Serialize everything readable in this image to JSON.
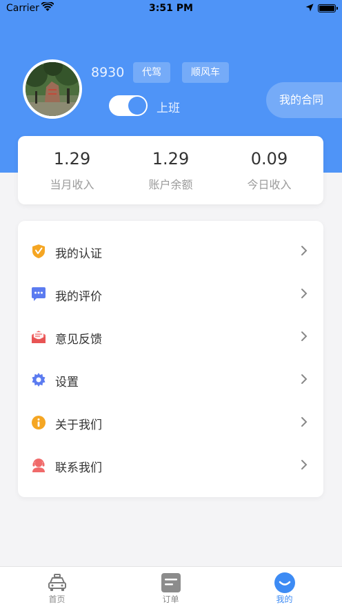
{
  "status_bar": {
    "carrier": "Carrier",
    "time": "3:51 PM"
  },
  "profile": {
    "user_id": "8930",
    "tags": [
      "代驾",
      "顺风车"
    ],
    "toggle_label": "上班",
    "toggle_on": true,
    "contract_button": "我的合同"
  },
  "stats": [
    {
      "value": "1.29",
      "label": "当月收入"
    },
    {
      "value": "1.29",
      "label": "账户余额"
    },
    {
      "value": "0.09",
      "label": "今日收入"
    }
  ],
  "menu": [
    {
      "label": "我的认证",
      "icon": "shield-check-icon",
      "color": "#f5a623"
    },
    {
      "label": "我的评价",
      "icon": "chat-bubble-icon",
      "color": "#5b7bf0"
    },
    {
      "label": "意见反馈",
      "icon": "mail-icon",
      "color": "#f06a6a"
    },
    {
      "label": "设置",
      "icon": "gear-icon",
      "color": "#5b7bf0"
    },
    {
      "label": "关于我们",
      "icon": "info-icon",
      "color": "#f5a623"
    },
    {
      "label": "联系我们",
      "icon": "support-agent-icon",
      "color": "#f06a6a"
    }
  ],
  "tabbar": [
    {
      "label": "首页",
      "icon": "car-icon",
      "active": false
    },
    {
      "label": "订单",
      "icon": "order-list-icon",
      "active": false
    },
    {
      "label": "我的",
      "icon": "profile-face-icon",
      "active": true
    }
  ],
  "colors": {
    "header_blue": "#4f94f7",
    "active_tab": "#3d8bf4",
    "page_bg": "#f4f4f6"
  }
}
